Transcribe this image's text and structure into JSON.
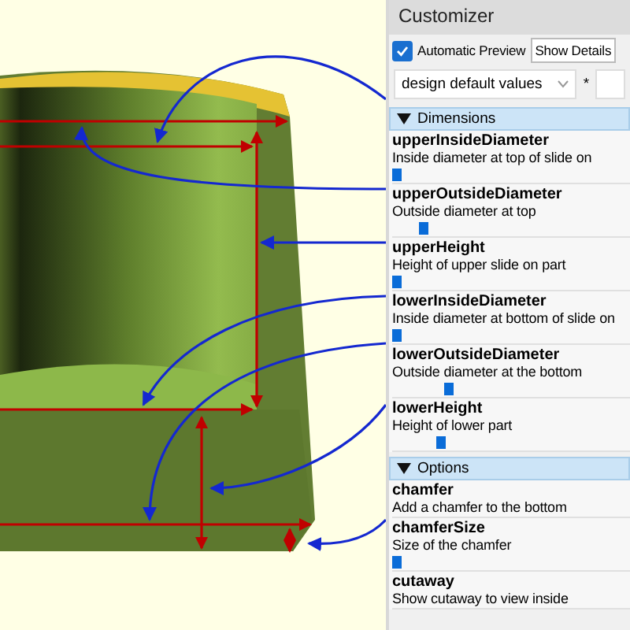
{
  "panel": {
    "title": "Customizer"
  },
  "preview": {
    "label": "Automatic Preview",
    "checked": true
  },
  "detail_select": {
    "value": "Show Details"
  },
  "preset": {
    "value": "design default values",
    "modified_mark": "*"
  },
  "groups": [
    {
      "title": "Dimensions",
      "expanded": true,
      "params": [
        {
          "name": "upperInsideDiameter",
          "description": "Inside diameter at top of slide on",
          "kind": "slider",
          "level": 0.0
        },
        {
          "name": "upperOutsideDiameter",
          "description": "Outside diameter at top",
          "kind": "slider",
          "level": 0.12
        },
        {
          "name": "upperHeight",
          "description": "Height of upper slide on part",
          "kind": "slider",
          "level": 0.0
        },
        {
          "name": "lowerInsideDiameter",
          "description": "Inside diameter at bottom of slide on",
          "kind": "slider",
          "level": 0.0
        },
        {
          "name": "lowerOutsideDiameter",
          "description": "Outside diameter at the bottom",
          "kind": "slider",
          "level": 0.24
        },
        {
          "name": "lowerHeight",
          "description": "Height of lower part",
          "kind": "slider",
          "level": 0.2
        }
      ]
    },
    {
      "title": "Options",
      "expanded": true,
      "params": [
        {
          "name": "chamfer",
          "description": "Add a chamfer to the bottom",
          "kind": "label"
        },
        {
          "name": "chamferSize",
          "description": "Size of the chamfer",
          "kind": "slider",
          "level": 0.0
        },
        {
          "name": "cutaway",
          "description": "Show cutaway to view inside",
          "kind": "label"
        }
      ]
    }
  ]
}
